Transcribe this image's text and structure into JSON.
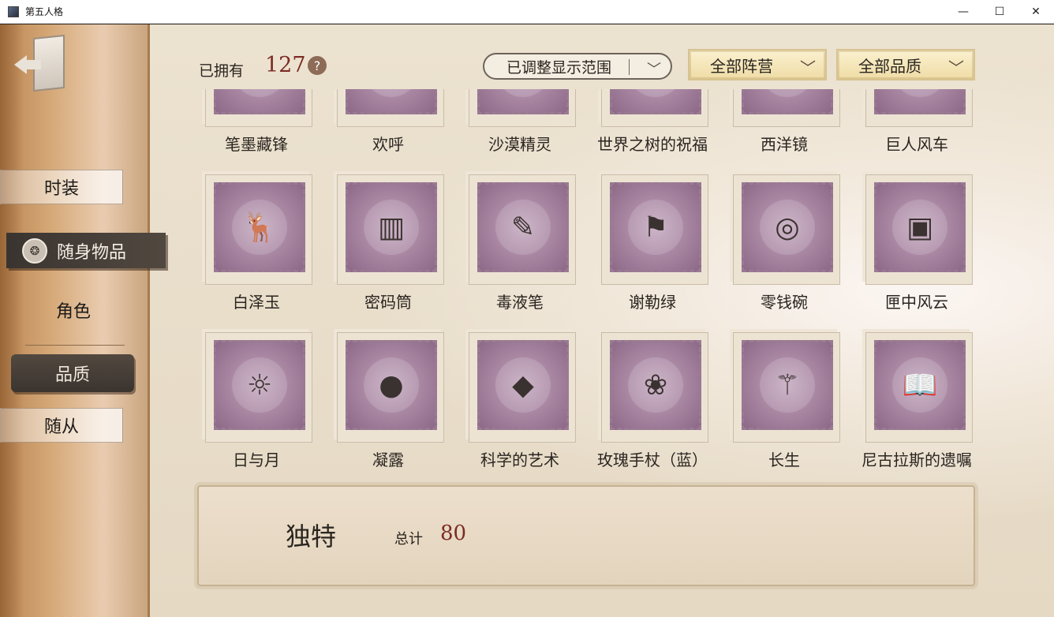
{
  "window": {
    "title": "第五人格",
    "minimize": "—",
    "maximize": "☐",
    "close": "✕"
  },
  "sidebar": {
    "back_icon": "exit-door-icon",
    "tabs": [
      {
        "label": "时装"
      },
      {
        "label": "随身物品",
        "selected": true
      },
      {
        "label": "角色"
      },
      {
        "label": "品质",
        "selected": true
      },
      {
        "label": "随从"
      }
    ]
  },
  "header": {
    "owned_label": "已拥有",
    "owned_count": "127",
    "help": "?",
    "filters": {
      "range": "已调整显示范围",
      "faction": "全部阵营",
      "quality": "全部品质"
    }
  },
  "items": [
    {
      "name": "笔墨藏锋",
      "icon": "✒"
    },
    {
      "name": "欢呼",
      "icon": "♪"
    },
    {
      "name": "沙漠精灵",
      "icon": "✿"
    },
    {
      "name": "世界之树的祝福",
      "icon": "❦"
    },
    {
      "name": "西洋镜",
      "icon": "◉"
    },
    {
      "name": "巨人风车",
      "icon": "✺"
    },
    {
      "name": "白泽玉",
      "icon": "🦌"
    },
    {
      "name": "密码筒",
      "icon": "▥"
    },
    {
      "name": "毒液笔",
      "icon": "✎"
    },
    {
      "name": "谢勒绿",
      "icon": "⚑"
    },
    {
      "name": "零钱碗",
      "icon": "◎"
    },
    {
      "name": "匣中风云",
      "icon": "▣"
    },
    {
      "name": "日与月",
      "icon": "☼"
    },
    {
      "name": "凝露",
      "icon": "●"
    },
    {
      "name": "科学的艺术",
      "icon": "◆"
    },
    {
      "name": "玫瑰手杖（蓝）",
      "icon": "❀"
    },
    {
      "name": "长生",
      "icon": "⚚"
    },
    {
      "name": "尼古拉斯的遗嘱",
      "icon": "📖"
    }
  ],
  "bottom": {
    "title": "独特",
    "total_label": "总计",
    "total": "80"
  },
  "colors": {
    "accent_red": "#7a2c24",
    "stamp_purple": "#a886a2",
    "gold_filter": "#efdca6"
  }
}
